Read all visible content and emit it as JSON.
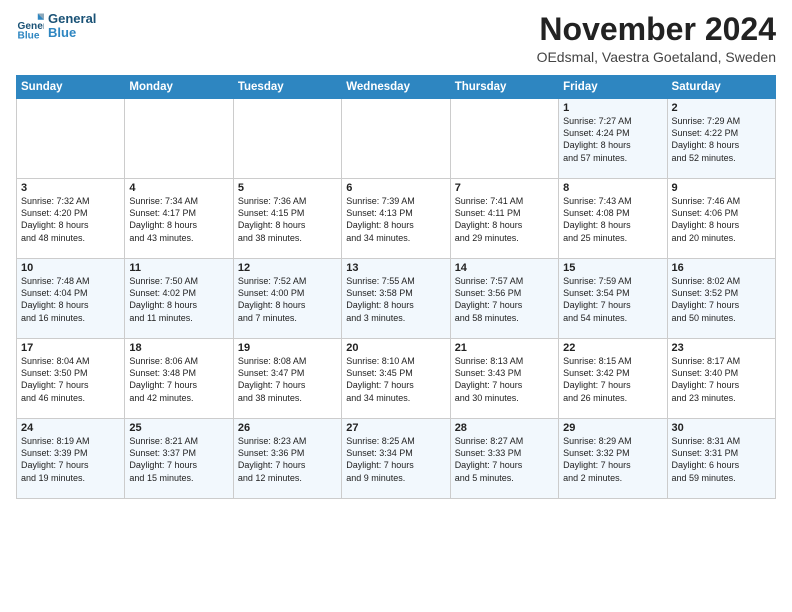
{
  "logo": {
    "line1": "General",
    "line2": "Blue"
  },
  "title": "November 2024",
  "location": "OEdsmal, Vaestra Goetaland, Sweden",
  "weekdays": [
    "Sunday",
    "Monday",
    "Tuesday",
    "Wednesday",
    "Thursday",
    "Friday",
    "Saturday"
  ],
  "weeks": [
    [
      {
        "day": "",
        "info": ""
      },
      {
        "day": "",
        "info": ""
      },
      {
        "day": "",
        "info": ""
      },
      {
        "day": "",
        "info": ""
      },
      {
        "day": "",
        "info": ""
      },
      {
        "day": "1",
        "info": "Sunrise: 7:27 AM\nSunset: 4:24 PM\nDaylight: 8 hours\nand 57 minutes."
      },
      {
        "day": "2",
        "info": "Sunrise: 7:29 AM\nSunset: 4:22 PM\nDaylight: 8 hours\nand 52 minutes."
      }
    ],
    [
      {
        "day": "3",
        "info": "Sunrise: 7:32 AM\nSunset: 4:20 PM\nDaylight: 8 hours\nand 48 minutes."
      },
      {
        "day": "4",
        "info": "Sunrise: 7:34 AM\nSunset: 4:17 PM\nDaylight: 8 hours\nand 43 minutes."
      },
      {
        "day": "5",
        "info": "Sunrise: 7:36 AM\nSunset: 4:15 PM\nDaylight: 8 hours\nand 38 minutes."
      },
      {
        "day": "6",
        "info": "Sunrise: 7:39 AM\nSunset: 4:13 PM\nDaylight: 8 hours\nand 34 minutes."
      },
      {
        "day": "7",
        "info": "Sunrise: 7:41 AM\nSunset: 4:11 PM\nDaylight: 8 hours\nand 29 minutes."
      },
      {
        "day": "8",
        "info": "Sunrise: 7:43 AM\nSunset: 4:08 PM\nDaylight: 8 hours\nand 25 minutes."
      },
      {
        "day": "9",
        "info": "Sunrise: 7:46 AM\nSunset: 4:06 PM\nDaylight: 8 hours\nand 20 minutes."
      }
    ],
    [
      {
        "day": "10",
        "info": "Sunrise: 7:48 AM\nSunset: 4:04 PM\nDaylight: 8 hours\nand 16 minutes."
      },
      {
        "day": "11",
        "info": "Sunrise: 7:50 AM\nSunset: 4:02 PM\nDaylight: 8 hours\nand 11 minutes."
      },
      {
        "day": "12",
        "info": "Sunrise: 7:52 AM\nSunset: 4:00 PM\nDaylight: 8 hours\nand 7 minutes."
      },
      {
        "day": "13",
        "info": "Sunrise: 7:55 AM\nSunset: 3:58 PM\nDaylight: 8 hours\nand 3 minutes."
      },
      {
        "day": "14",
        "info": "Sunrise: 7:57 AM\nSunset: 3:56 PM\nDaylight: 7 hours\nand 58 minutes."
      },
      {
        "day": "15",
        "info": "Sunrise: 7:59 AM\nSunset: 3:54 PM\nDaylight: 7 hours\nand 54 minutes."
      },
      {
        "day": "16",
        "info": "Sunrise: 8:02 AM\nSunset: 3:52 PM\nDaylight: 7 hours\nand 50 minutes."
      }
    ],
    [
      {
        "day": "17",
        "info": "Sunrise: 8:04 AM\nSunset: 3:50 PM\nDaylight: 7 hours\nand 46 minutes."
      },
      {
        "day": "18",
        "info": "Sunrise: 8:06 AM\nSunset: 3:48 PM\nDaylight: 7 hours\nand 42 minutes."
      },
      {
        "day": "19",
        "info": "Sunrise: 8:08 AM\nSunset: 3:47 PM\nDaylight: 7 hours\nand 38 minutes."
      },
      {
        "day": "20",
        "info": "Sunrise: 8:10 AM\nSunset: 3:45 PM\nDaylight: 7 hours\nand 34 minutes."
      },
      {
        "day": "21",
        "info": "Sunrise: 8:13 AM\nSunset: 3:43 PM\nDaylight: 7 hours\nand 30 minutes."
      },
      {
        "day": "22",
        "info": "Sunrise: 8:15 AM\nSunset: 3:42 PM\nDaylight: 7 hours\nand 26 minutes."
      },
      {
        "day": "23",
        "info": "Sunrise: 8:17 AM\nSunset: 3:40 PM\nDaylight: 7 hours\nand 23 minutes."
      }
    ],
    [
      {
        "day": "24",
        "info": "Sunrise: 8:19 AM\nSunset: 3:39 PM\nDaylight: 7 hours\nand 19 minutes."
      },
      {
        "day": "25",
        "info": "Sunrise: 8:21 AM\nSunset: 3:37 PM\nDaylight: 7 hours\nand 15 minutes."
      },
      {
        "day": "26",
        "info": "Sunrise: 8:23 AM\nSunset: 3:36 PM\nDaylight: 7 hours\nand 12 minutes."
      },
      {
        "day": "27",
        "info": "Sunrise: 8:25 AM\nSunset: 3:34 PM\nDaylight: 7 hours\nand 9 minutes."
      },
      {
        "day": "28",
        "info": "Sunrise: 8:27 AM\nSunset: 3:33 PM\nDaylight: 7 hours\nand 5 minutes."
      },
      {
        "day": "29",
        "info": "Sunrise: 8:29 AM\nSunset: 3:32 PM\nDaylight: 7 hours\nand 2 minutes."
      },
      {
        "day": "30",
        "info": "Sunrise: 8:31 AM\nSunset: 3:31 PM\nDaylight: 6 hours\nand 59 minutes."
      }
    ]
  ]
}
